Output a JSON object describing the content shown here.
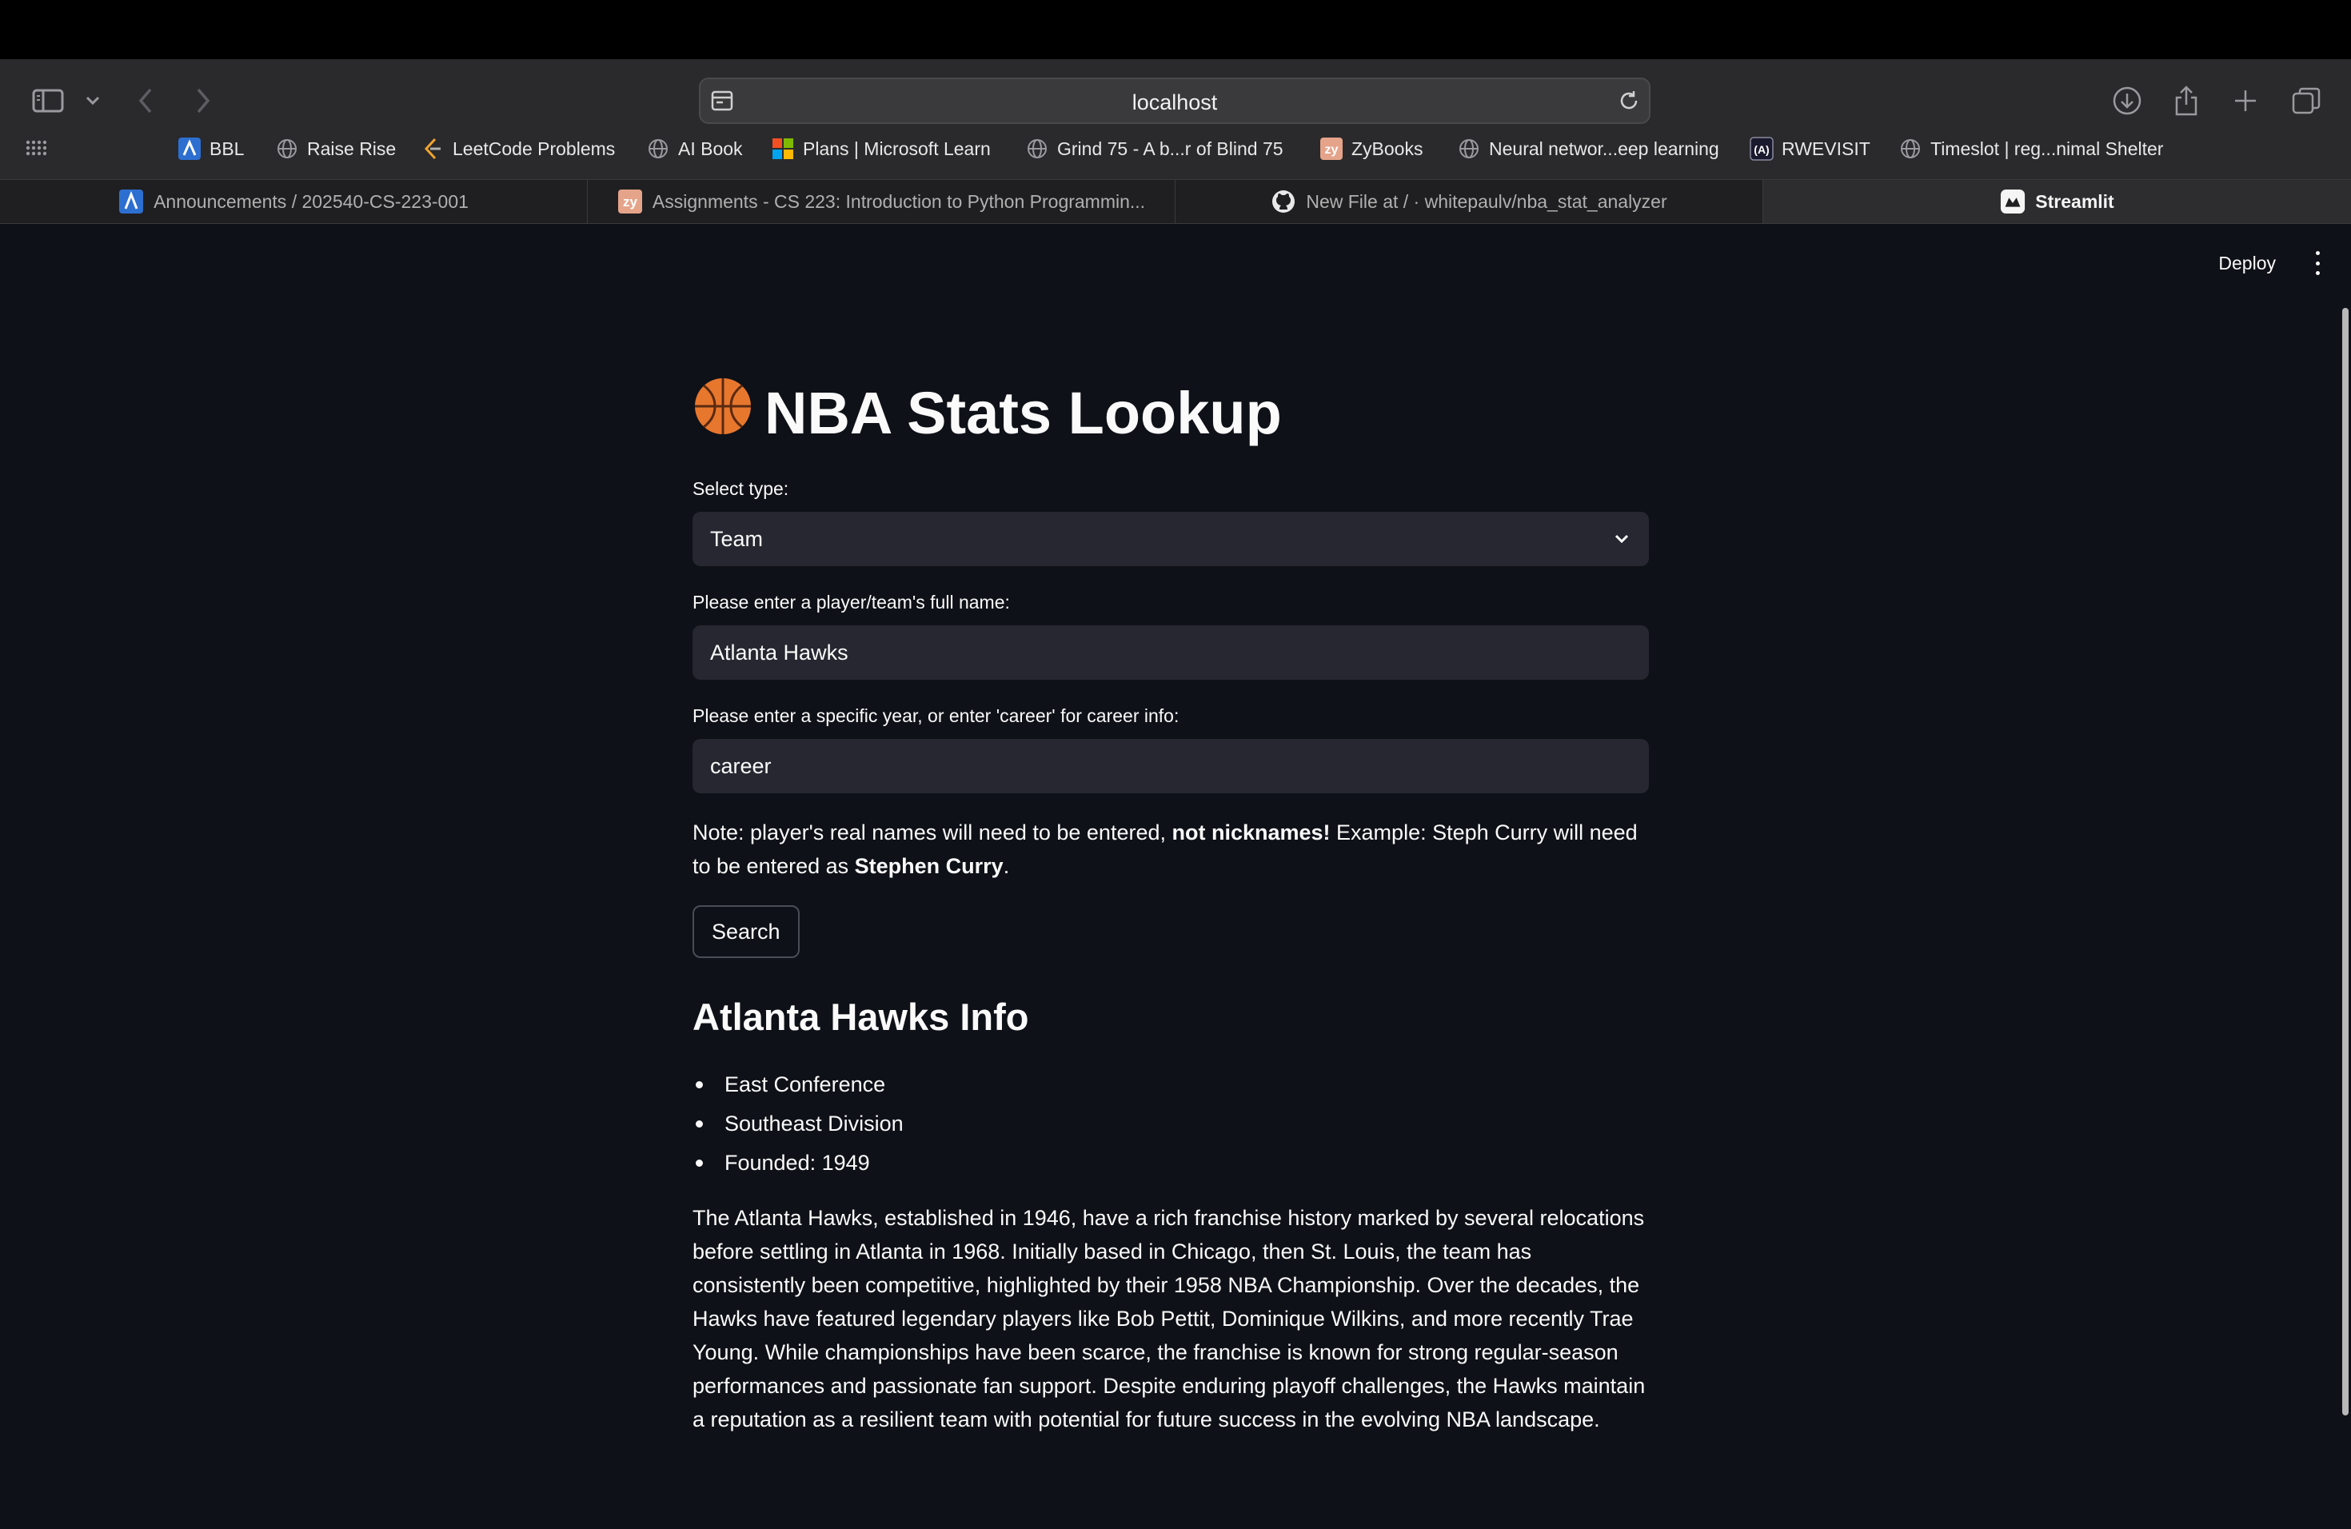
{
  "browser": {
    "url": "localhost",
    "bookmarks": [
      {
        "label": "BBL",
        "icon": "canvas-icon"
      },
      {
        "label": "Raise Rise",
        "icon": "globe-icon"
      },
      {
        "label": "LeetCode Problems",
        "icon": "leetcode-icon"
      },
      {
        "label": "AI Book",
        "icon": "globe-icon"
      },
      {
        "label": "Plans | Microsoft Learn",
        "icon": "microsoft-icon"
      },
      {
        "label": "Grind 75 - A b...r of Blind 75",
        "icon": "globe-icon"
      },
      {
        "label": "ZyBooks",
        "icon": "zybooks-icon"
      },
      {
        "label": "Neural networ...eep learning",
        "icon": "globe-icon"
      },
      {
        "label": "RWEVISIT",
        "icon": "rwevisit-icon"
      },
      {
        "label": "Timeslot | reg...nimal Shelter",
        "icon": "globe-icon"
      }
    ],
    "tabs": [
      {
        "label": "Announcements / 202540-CS-223-001",
        "icon": "canvas-icon",
        "active": false
      },
      {
        "label": "Assignments - CS 223: Introduction to Python Programmin...",
        "icon": "zybooks-icon",
        "active": false
      },
      {
        "label": "New File at / · whitepaulv/nba_stat_analyzer",
        "icon": "github-icon",
        "active": false
      },
      {
        "label": "Streamlit",
        "icon": "streamlit-icon",
        "active": true
      }
    ]
  },
  "app": {
    "deploy_label": "Deploy",
    "title": "NBA Stats Lookup",
    "title_emoji": "basketball-icon",
    "type_label": "Select type:",
    "type_value": "Team",
    "name_label": "Please enter a player/team's full name:",
    "name_value": "Atlanta Hawks",
    "year_label": "Please enter a specific year, or enter 'career' for career info:",
    "year_value": "career",
    "note": {
      "part1": "Note: player's real names will need to be entered, ",
      "bold1": "not nicknames!",
      "part2": " Example: Steph Curry will need to be entered as ",
      "bold2": "Stephen Curry",
      "part3": "."
    },
    "search_label": "Search",
    "result_heading": "Atlanta Hawks Info",
    "result_bullets": [
      "East Conference",
      "Southeast Division",
      "Founded: 1949"
    ],
    "result_paragraph": "The Atlanta Hawks, established in 1946, have a rich franchise history marked by several relocations before settling in Atlanta in 1968. Initially based in Chicago, then St. Louis, the team has consistently been competitive, highlighted by their 1958 NBA Championship. Over the decades, the Hawks have featured legendary players like Bob Pettit, Dominique Wilkins, and more recently Trae Young. While championships have been scarce, the franchise is known for strong regular-season performances and passionate fan support. Despite enduring playoff challenges, the Hawks maintain a reputation as a resilient team with potential for future success in the evolving NBA landscape."
  },
  "colors": {
    "page_bg": "#0e1117",
    "input_bg": "#262730",
    "text": "#fafafa",
    "chrome_bg": "#2a2a2c"
  }
}
